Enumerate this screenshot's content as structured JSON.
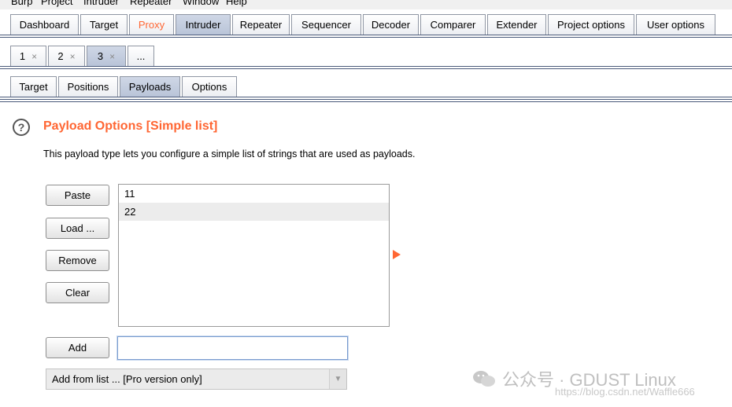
{
  "menubar": {
    "items": [
      "Burp",
      "Project",
      "Intruder",
      "Repeater",
      "Window",
      "Help"
    ]
  },
  "main_tabs": [
    {
      "label": "Dashboard"
    },
    {
      "label": "Target"
    },
    {
      "label": "Proxy"
    },
    {
      "label": "Intruder"
    },
    {
      "label": "Repeater"
    },
    {
      "label": "Sequencer"
    },
    {
      "label": "Decoder"
    },
    {
      "label": "Comparer"
    },
    {
      "label": "Extender"
    },
    {
      "label": "Project options"
    },
    {
      "label": "User options"
    }
  ],
  "main_tabs_selected": "Intruder",
  "main_tabs_highlight": "Proxy",
  "attack_tabs": [
    {
      "label": "1",
      "close": "×"
    },
    {
      "label": "2",
      "close": "×"
    },
    {
      "label": "3",
      "close": "×"
    },
    {
      "label": "..."
    }
  ],
  "sub_tabs": [
    {
      "label": "Target"
    },
    {
      "label": "Positions"
    },
    {
      "label": "Payloads"
    },
    {
      "label": "Options"
    }
  ],
  "payload_options": {
    "help_icon": "?",
    "title": "Payload Options [Simple list]",
    "description": "This payload type lets you configure a simple list of strings that are used as payloads.",
    "buttons": {
      "paste": "Paste",
      "load": "Load ...",
      "remove": "Remove",
      "clear": "Clear",
      "add": "Add"
    },
    "list_items": [
      "11",
      "22"
    ],
    "add_value": "",
    "add_from_list": "Add from list ... [Pro version only]"
  },
  "watermark": {
    "text": "公众号 · GDUST Linux",
    "url": "https://blog.csdn.net/Waffle666"
  },
  "colors": {
    "accent": "#ff6633",
    "selected_tab": "#c3cde0",
    "border_line": "#4a5a7a"
  }
}
